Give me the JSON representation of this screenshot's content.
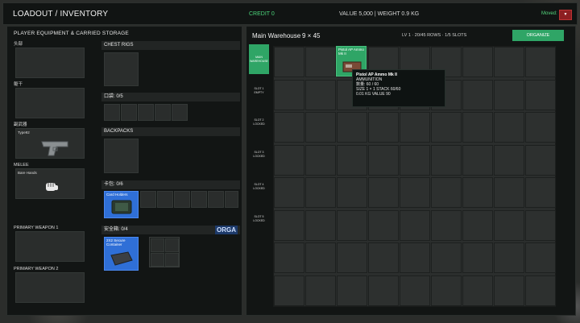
{
  "header": {
    "title": "LOADOUT / INVENTORY",
    "credit": "CREDIT 0",
    "value_weight": "VALUE 5,000  |  WEIGHT 0.9 KG",
    "moved_label": "Moved:",
    "moved_button": "▼"
  },
  "left": {
    "title": "PLAYER EQUIPMENT & CARRIED STORAGE",
    "slots": [
      {
        "label": "头部",
        "item": ""
      },
      {
        "label": "躯干",
        "item": ""
      },
      {
        "label": "副武器",
        "item": "Type92"
      },
      {
        "label": "MELEE",
        "item": "Bare Hands"
      },
      {
        "label": "PRIMARY WEAPON 1",
        "item": ""
      },
      {
        "label": "PRIMARY WEAPON 2",
        "item": ""
      }
    ],
    "chest_rigs": "CHEST RIGS",
    "pockets": "口袋: 0/5",
    "backpacks": "BACKPACKS",
    "card_pack": "卡包: 0/6",
    "card_item": "Card Holders",
    "safe_box": "安全箱: 0/4",
    "safe_item": "2X2 Secure Container",
    "orga": "ORGA"
  },
  "warehouse": {
    "title": "Main Warehouse",
    "dims": "9 × 45",
    "stats": "LV 1   ·   20/45 ROWS   ·   1/5 SLOTS",
    "organize": "ORGANIZE",
    "tabs": [
      {
        "line1": "MAIN",
        "line2": "WAREHOUSE"
      },
      {
        "line1": "SLOT 1",
        "line2": "EMPTY"
      },
      {
        "line1": "SLOT 2",
        "line2": "LOCKED"
      },
      {
        "line1": "SLOT 3",
        "line2": "LOCKED"
      },
      {
        "line1": "SLOT 4",
        "line2": "LOCKED"
      },
      {
        "line1": "SLOT 5",
        "line2": "LOCKED"
      }
    ],
    "item_name": "Pistol AP Ammo Mk II",
    "tooltip": {
      "name": "Pistol AP Ammo Mk II",
      "category": "AMMUNITION",
      "qty": "数量: 60 / 60",
      "size": "SIZE 1 × 1   STACK 60/60",
      "weight_value": "0.01 KG   VALUE 90"
    }
  },
  "colors": {
    "accent_green": "#2fa566",
    "blue": "#2f6fd7",
    "red": "#8e1f22"
  }
}
